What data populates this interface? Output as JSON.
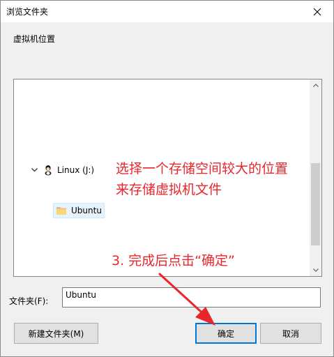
{
  "dialog": {
    "title": "浏览文件夹",
    "location_label": "虚拟机位置"
  },
  "tree": {
    "items": [
      {
        "label": "Linux (J:)",
        "icon": "drive-icon",
        "expanded": true
      },
      {
        "label": "Ubuntu",
        "icon": "folder-icon",
        "selected": true
      }
    ]
  },
  "annotations": {
    "line1": "选择一个存储空间较大的位置",
    "line2": "来存储虚拟机文件",
    "line3": "3. 完成后点击“确定”",
    "color": "#e8262b"
  },
  "folder_field": {
    "label": "文件夹(F):",
    "value": "Ubuntu"
  },
  "buttons": {
    "new_folder": "新建文件夹(M)",
    "ok": "确定",
    "cancel": "取消"
  },
  "colors": {
    "selection_bg": "#e5f3ff",
    "default_button_border": "#0078d7"
  }
}
